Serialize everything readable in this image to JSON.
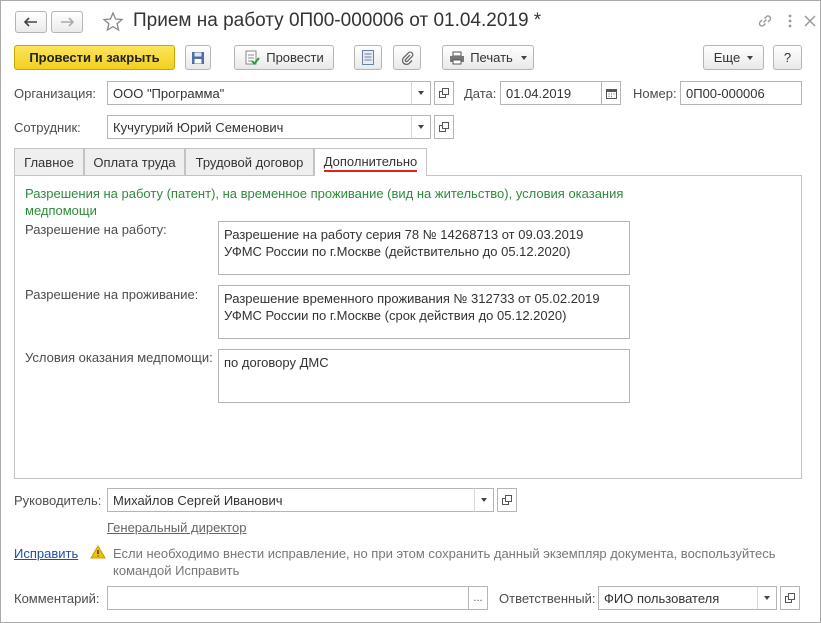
{
  "window": {
    "title": "Прием на работу 0П00-000006 от 01.04.2019 *"
  },
  "toolbar": {
    "post_close_label": "Провести и закрыть",
    "post_label": "Провести",
    "print_label": "Печать",
    "more_label": "Еще",
    "help_label": "?"
  },
  "header": {
    "org_label": "Организация:",
    "org_value": "ООО \"Программа\"",
    "date_label": "Дата:",
    "date_value": "01.04.2019",
    "number_label": "Номер:",
    "number_value": "0П00-000006",
    "employee_label": "Сотрудник:",
    "employee_value": "Кучугурий Юрий Семенович"
  },
  "tabs": [
    {
      "label": "Главное"
    },
    {
      "label": "Оплата труда"
    },
    {
      "label": "Трудовой договор"
    },
    {
      "label": "Дополнительно"
    }
  ],
  "additional": {
    "section_title": "Разрешения на работу (патент), на временное проживание (вид на жительство), условия оказания медпомощи",
    "work_permit_label": "Разрешение на работу:",
    "work_permit_line1": "Разрешение на работу серия 78 № 14268713 от 09.03.2019",
    "work_permit_line2": "УФМС России по г.Москве (действительно до 05.12.2020)",
    "residence_label": "Разрешение на проживание:",
    "residence_line1": "Разрешение временного проживания № 312733 от 05.02.2019",
    "residence_line2": "УФМС России по г.Москве (срок действия до 05.12.2020)",
    "medical_label": "Условия оказания медпомощи:",
    "medical_value": "по договору ДМС"
  },
  "footer": {
    "manager_label": "Руководитель:",
    "manager_value": "Михайлов Сергей Иванович",
    "manager_position": "Генеральный директор",
    "fix_link": "Исправить",
    "fix_hint": "Если необходимо внести исправление, но при этом сохранить данный экземпляр документа, воспользуйтесь командой Исправить",
    "comment_label": "Комментарий:",
    "comment_value": "",
    "comment_btn": "...",
    "responsible_label": "Ответственный:",
    "responsible_value": "ФИО пользователя"
  },
  "colors": {
    "accent_yellow": "#f5d325",
    "section_green": "#2e8b3a",
    "link_blue": "#1c4fa8",
    "active_tab_underline": "#e2231a",
    "warning_yellow": "#f2c200"
  }
}
